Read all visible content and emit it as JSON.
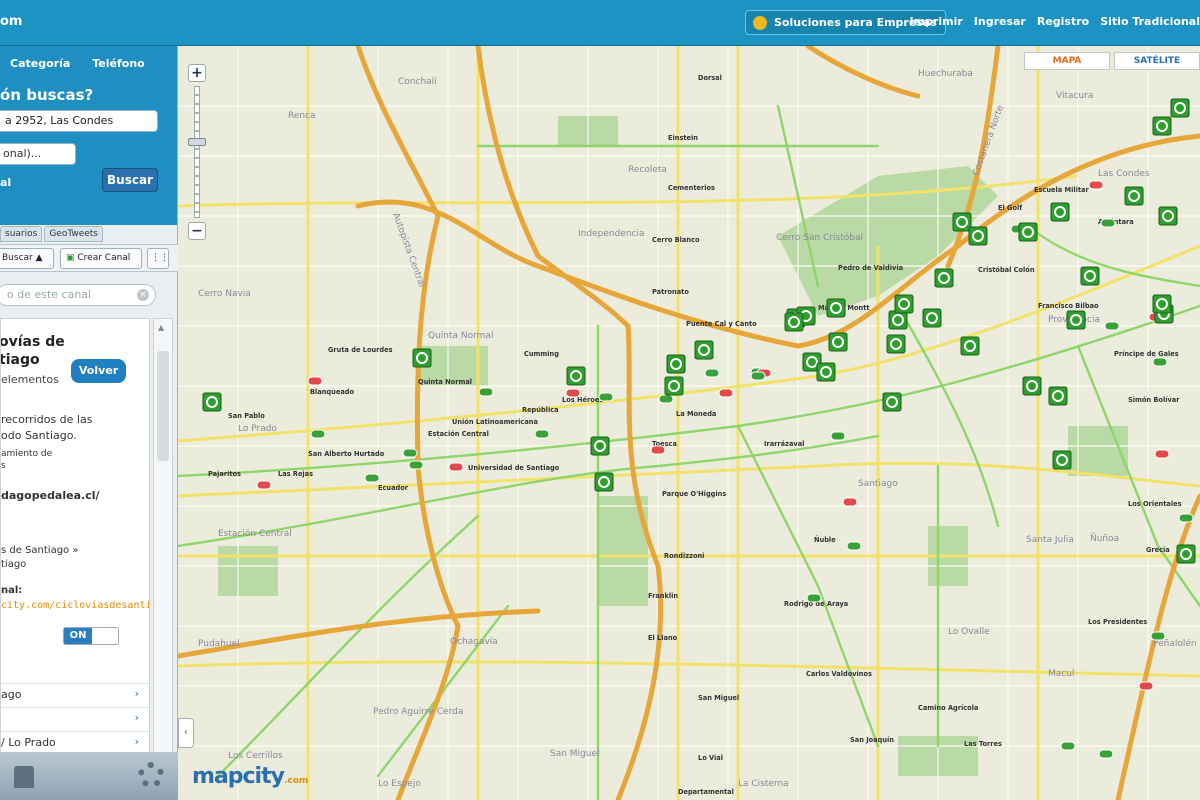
{
  "topbar": {
    "logo_fragment": "om",
    "business_button": "Soluciones para Empresas",
    "nav": [
      "Imprimir",
      "Ingresar",
      "Registro",
      "Sitio Tradicional"
    ]
  },
  "sidebar": {
    "tabs": [
      "Categoría",
      "Teléfono"
    ],
    "search_title": "ón buscas?",
    "address_value": "a 2952, Las Condes",
    "city_value": "onal)...",
    "advanced_link": "al",
    "search_button": "Buscar",
    "subtabs": [
      "suarios",
      "GeoTweets"
    ],
    "toolbar": {
      "search_label": "Buscar",
      "create_channel": "Crear Canal"
    },
    "filter_placeholder": "o de este canal",
    "channel": {
      "title_line1": "ovías de",
      "title_line2": "tiago",
      "count": "elementos",
      "back_button": "Volver",
      "desc_line1": "recorridos de las",
      "desc_line2": "odo Santiago.",
      "author_line1": "amiento de",
      "author_line2": "s",
      "site_link": "dagopedalea.cl/",
      "category_line1": "s de Santiago »",
      "category_line2": "tiago",
      "url_label": "nal:",
      "url_value": "city.com/cicloviasdesantia",
      "toggle_on": "ON",
      "rows": [
        "ago",
        "",
        "/ Lo Prado"
      ]
    }
  },
  "map": {
    "type_buttons": [
      "MAPA",
      "SATÉLITE"
    ],
    "selected_type": "MAPA",
    "logo": "mapcity",
    "logo_suffix": ".com",
    "colors": {
      "highway": "#e7a63a",
      "major_road": "#f2e26a",
      "bike_lane": "#8ed66a",
      "park": "#b9d9a5",
      "marker": "#2f9e2f",
      "metro": "#e04a4a"
    },
    "labels": [
      "Renca",
      "Conchalí",
      "Huechuraba",
      "Recoleta",
      "Cerro Navia",
      "Quinta Normal",
      "Independencia",
      "Cerro San Cristóbal",
      "Vitacura",
      "Las Condes",
      "Providencia",
      "Estación Central",
      "Santiago",
      "Ñuñoa",
      "Lo Prado",
      "Pudahuel",
      "San Miguel",
      "Pedro Aguirre Cerda",
      "Lo Espejo",
      "Macul",
      "La Cisterna",
      "Peñalolén",
      "Autopista Central",
      "Costanera Norte",
      "Dorsal",
      "Einstein",
      "Cementerios",
      "Cerro Blanco",
      "Patronato",
      "Puente Cal y Canto",
      "Manuel Montt",
      "Pedro de Valdivia",
      "Cristóbal Colón",
      "Escuela Militar",
      "El Golf",
      "Alcántara",
      "Francisco Bilbao",
      "Príncipe de Gales",
      "Simón Bolívar",
      "Los Orientales",
      "Grecia",
      "Los Presidentes",
      "Quinta Normal",
      "Blanqueado",
      "Gruta de Lourdes",
      "Cumming",
      "Los Héroes",
      "República",
      "Unión Latinoamericana",
      "Estación Central",
      "San Pablo",
      "Pajaritos",
      "Las Rejas",
      "Ecuador",
      "San Alberto Hurtado",
      "Universidad de Santiago",
      "Parque O'Higgins",
      "Toesca",
      "La Moneda",
      "Irarrázaval",
      "Rondizzoni",
      "Franklin",
      "El Llano",
      "Ñuble",
      "Rodrigo de Araya",
      "Carlos Valdovinos",
      "Camino Agrícola",
      "San Joaquín",
      "Las Torres",
      "San Miguel",
      "Lo Vial",
      "Departamental",
      "Ochagavía",
      "Santa Julia",
      "Los Cerrillos",
      "Lo Ovalle"
    ]
  }
}
